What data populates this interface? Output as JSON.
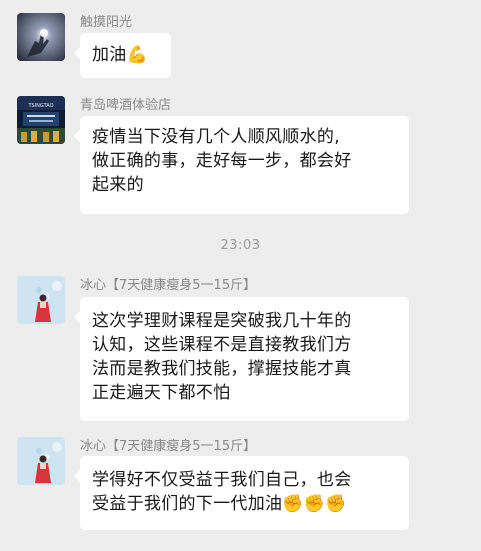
{
  "colors": {
    "background": "#ededed",
    "bubble": "#ffffff",
    "text": "#191919",
    "sender": "#8a8a8a",
    "time": "#9a9a9a"
  },
  "messages": [
    {
      "sender": "触摸阳光",
      "avatar_icon": "sunlight-hand-avatar-icon",
      "lines": [
        "加油"
      ],
      "emoji": "💪"
    },
    {
      "sender": "青岛啤酒体验店",
      "avatar_icon": "beer-store-avatar-icon",
      "lines": [
        "疫情当下没有几个人顺风顺水的,",
        "做正确的事，走好每一步，都会好",
        "起来的"
      ]
    },
    {
      "sender": "冰心【7天健康瘦身5一15斤】",
      "avatar_icon": "woman-red-dress-avatar-icon",
      "lines": [
        "这次学理财课程是突破我几十年的",
        "认知，这些课程不是直接教我们方",
        "法而是教我们技能，撑握技能才真",
        "正走遍天下都不怕"
      ]
    },
    {
      "sender": "冰心【7天健康瘦身5一15斤】",
      "avatar_icon": "woman-red-dress-avatar-icon",
      "lines": [
        "学得好不仅受益于我们自己，也会",
        "受益于我们的下一代加油"
      ],
      "emoji": "✊✊✊"
    }
  ],
  "time_label": "23:03"
}
